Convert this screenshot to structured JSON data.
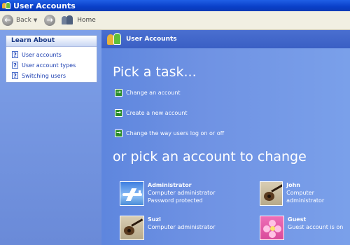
{
  "window": {
    "title": "User Accounts"
  },
  "toolbar": {
    "back_label": "Back",
    "home_label": "Home"
  },
  "learn_about": {
    "title": "Learn About",
    "items": [
      {
        "label": "User accounts"
      },
      {
        "label": "User account types"
      },
      {
        "label": "Switching users"
      }
    ]
  },
  "main": {
    "header_title": "User Accounts",
    "pick_task_heading": "Pick a task...",
    "tasks": [
      {
        "label": "Change an account"
      },
      {
        "label": "Create a new account"
      },
      {
        "label": "Change the way users log on or off"
      }
    ],
    "pick_account_heading": "or pick an account to change",
    "accounts": [
      {
        "name": "Administrator",
        "line1": "Computer administrator",
        "line2": "Password protected",
        "picture": "airplane"
      },
      {
        "name": "John",
        "line1": "Computer administrator",
        "line2": "",
        "picture": "guitar"
      },
      {
        "name": "Suzi",
        "line1": "Computer administrator",
        "line2": "",
        "picture": "guitar"
      },
      {
        "name": "Guest",
        "line1": "Guest account is on",
        "line2": "",
        "picture": "flower"
      }
    ]
  },
  "colors": {
    "titlebar": "#0a3fc8",
    "main_background": "#6a8ad8",
    "task_arrow": "#2a8d2a",
    "link": "#1a3db0"
  },
  "icons": {
    "title": "user-accounts-icon",
    "back": "back-arrow-icon",
    "forward": "forward-arrow-icon",
    "home": "home-users-icon",
    "help": "help-question-icon",
    "task": "green-arrow-icon"
  }
}
